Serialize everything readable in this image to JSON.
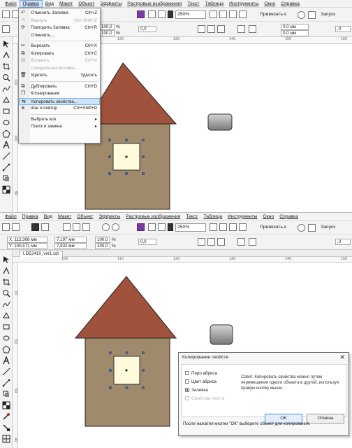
{
  "menu": [
    "Файл",
    "Правка",
    "Вид",
    "Макет",
    "Объект",
    "Эффекты",
    "Растровые изображения",
    "Текст",
    "Таблица",
    "Инструменты",
    "Окно",
    "Справка"
  ],
  "active_menu": "Правка",
  "toolbar": {
    "zoom": "250%",
    "snap": "Привязать к",
    "launch": "Запуск",
    "outline_width": "0,0",
    "outline_width2": "0,0",
    "dash": ",0"
  },
  "props_top": {
    "x": "X:",
    "y": "Y:",
    "width": "0,0 мм",
    "height": "0,0 мм",
    "scale_x": "100,0",
    "scale_y": "100,0",
    "pct": "%"
  },
  "props_bottom": {
    "x": "X: 112,308 мм",
    "y": "Y: 100,571 мм",
    "width": "7,197 мм",
    "height": "7,832 мм",
    "scale_x": "100,0",
    "scale_y": "100,0",
    "pct": "%"
  },
  "document_tab": "LDE2410_ver1.cdr",
  "rulers": {
    "h_top": [
      "120",
      "130",
      "140",
      "150",
      "160"
    ],
    "h_bottom": [
      "100",
      "110",
      "120",
      "130",
      "140",
      "150"
    ],
    "v_top": [
      "110",
      "100",
      "90"
    ],
    "v_bottom": [
      "70",
      "60",
      "50",
      "40"
    ]
  },
  "dropdown": [
    {
      "label": "Отменить Заливка",
      "shortcut": "Ctrl+Z",
      "disabled": false,
      "icon": "undo-icon"
    },
    {
      "label": "Вернуть",
      "shortcut": "Ctrl+Shift+Z",
      "disabled": true,
      "icon": "redo-icon"
    },
    {
      "label": "Повторить Заливка",
      "shortcut": "Ctrl+R",
      "disabled": false,
      "icon": "repeat-icon"
    },
    {
      "label": "Отменить...",
      "shortcut": "",
      "disabled": false,
      "icon": ""
    },
    {
      "sep": true
    },
    {
      "label": "Вырезать",
      "shortcut": "Ctrl+X",
      "disabled": false,
      "icon": "cut-icon"
    },
    {
      "label": "Копировать",
      "shortcut": "Ctrl+C",
      "disabled": false,
      "icon": "copy-icon"
    },
    {
      "label": "Вставить",
      "shortcut": "Ctrl+V",
      "disabled": true,
      "icon": "paste-icon"
    },
    {
      "label": "Специальная вставка...",
      "shortcut": "",
      "disabled": true,
      "icon": ""
    },
    {
      "label": "Удалить",
      "shortcut": "Удалить",
      "disabled": false,
      "icon": "delete-icon"
    },
    {
      "sep": true
    },
    {
      "label": "Дублировать",
      "shortcut": "Ctrl+D",
      "disabled": false,
      "icon": "duplicate-icon"
    },
    {
      "label": "Клонирование",
      "shortcut": "",
      "disabled": false,
      "icon": "clone-icon"
    },
    {
      "label": "Копировать свойства...",
      "shortcut": "",
      "disabled": false,
      "highlight": true,
      "icon": "copy-properties-icon"
    },
    {
      "label": "Шаг и повтор",
      "shortcut": "Ctrl+Shift+D",
      "disabled": false,
      "icon": "step-repeat-icon"
    },
    {
      "sep": true
    },
    {
      "label": "Выбрать все",
      "shortcut": "▸",
      "disabled": false,
      "icon": ""
    },
    {
      "label": "Поиск и замена",
      "shortcut": "▸",
      "disabled": false,
      "icon": ""
    }
  ],
  "dialog": {
    "title": "Копирование свойств",
    "close": "✕",
    "checkboxes": [
      {
        "label": "Перо абриса",
        "checked": false,
        "disabled": false
      },
      {
        "label": "Цвет абриса",
        "checked": false,
        "disabled": false
      },
      {
        "label": "Заливка",
        "checked": true,
        "disabled": false
      },
      {
        "label": "Свойства текста",
        "checked": false,
        "disabled": true
      }
    ],
    "hint": "Совет. Копировать свойства можно путем перемещения одного объекта в другой, используя правую кнопку мыши.",
    "ok": "OK",
    "cancel": "Отмена",
    "footer": "После нажатия кнопки \"ОК\" выберите объект для копирования."
  },
  "colors": {
    "roof": "#a0523c",
    "wall": "#a08a6c",
    "window": "#fffadc",
    "button_shape_top": "#d0d0d0",
    "button_shape_bottom": "#7a7a7a",
    "handle": "#4a5d80"
  }
}
